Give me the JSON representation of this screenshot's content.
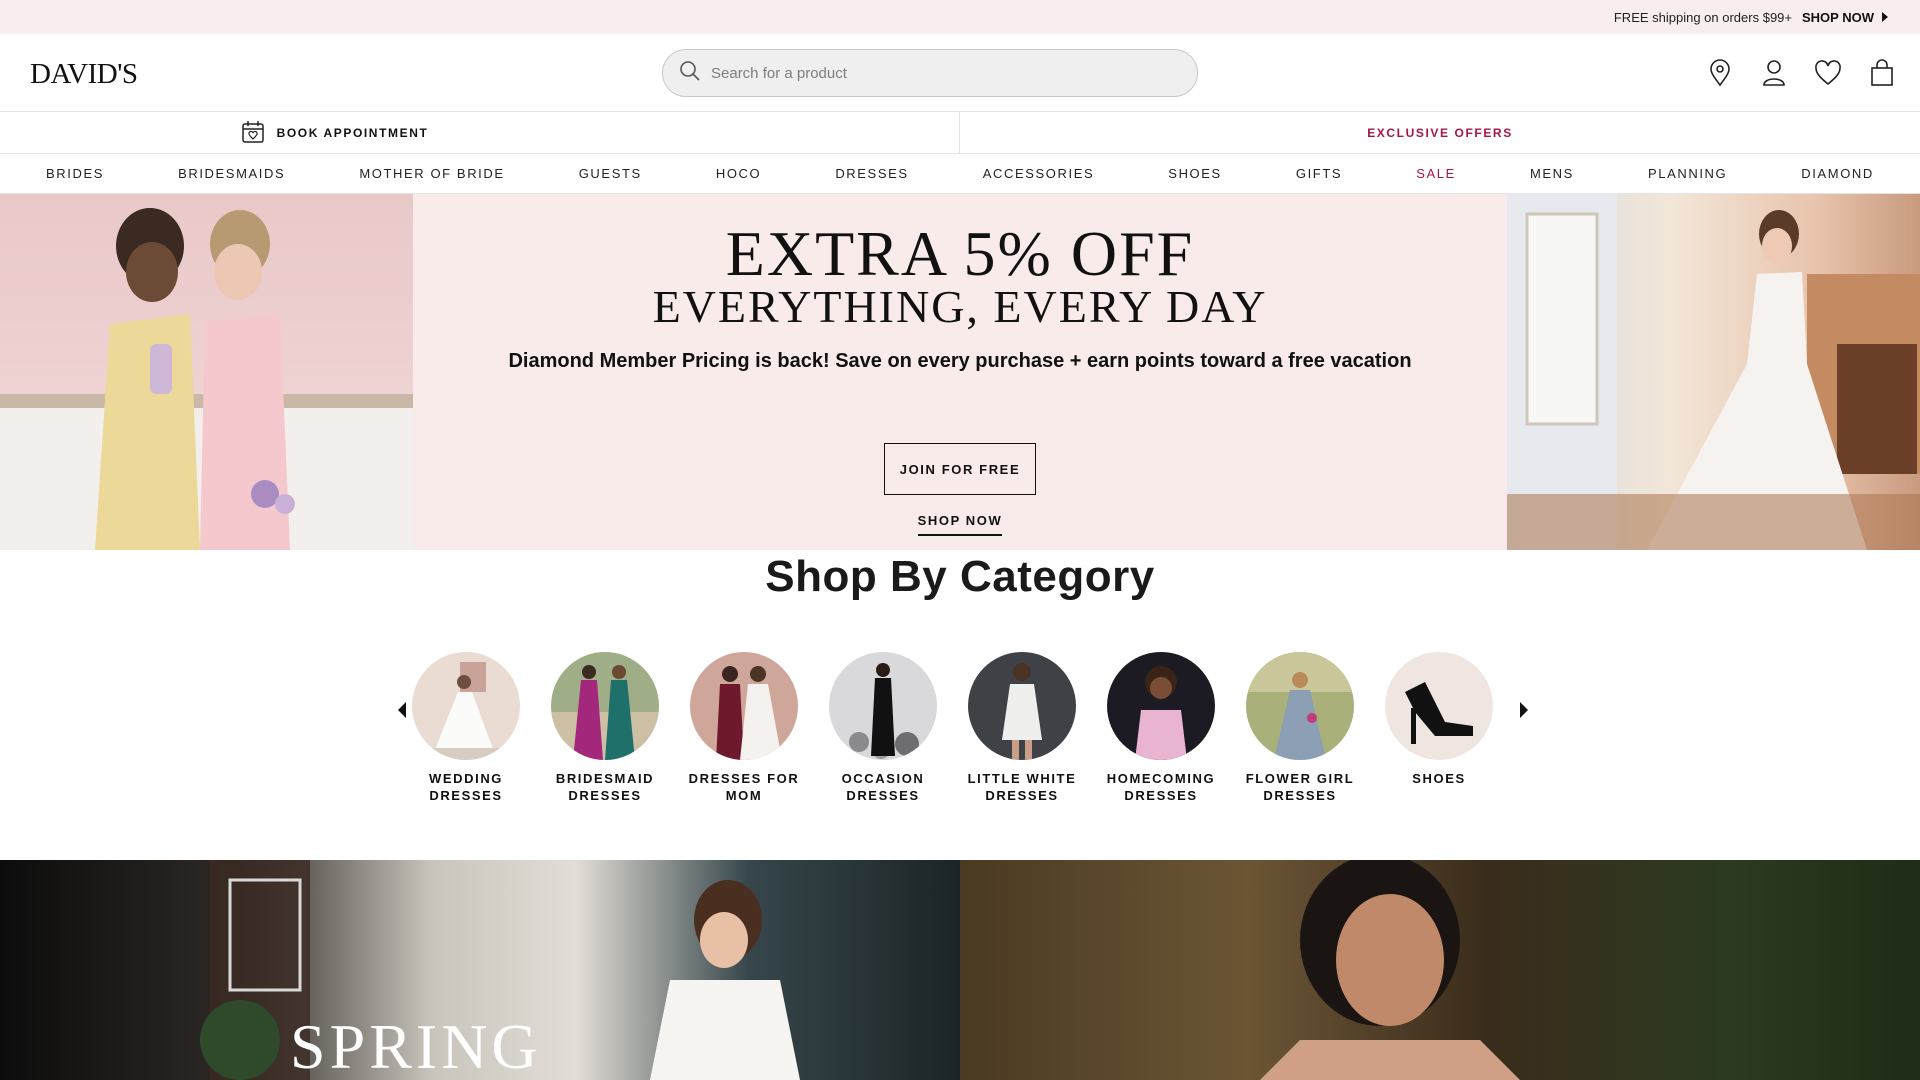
{
  "promo": {
    "text": "FREE shipping on orders $99+",
    "link": "SHOP NOW"
  },
  "header": {
    "logo": "DAVID'S",
    "search_placeholder": "Search for a product"
  },
  "subnav": {
    "appointment": "BOOK APPOINTMENT",
    "offers": "EXCLUSIVE OFFERS"
  },
  "nav": [
    "BRIDES",
    "BRIDESMAIDS",
    "MOTHER OF BRIDE",
    "GUESTS",
    "HOCO",
    "DRESSES",
    "ACCESSORIES",
    "SHOES",
    "GIFTS",
    "SALE",
    "MENS",
    "PLANNING",
    "DIAMOND"
  ],
  "hero": {
    "headline_1": "EXTRA 5% OFF",
    "headline_2": "EVERYTHING, EVERY DAY",
    "subhead": "Diamond Member Pricing is back! Save on every purchase + earn points toward a free vacation",
    "button": "JOIN FOR FREE",
    "link": "SHOP NOW"
  },
  "category": {
    "title": "Shop By Category",
    "items": [
      {
        "line1": "WEDDING",
        "line2": "DRESSES"
      },
      {
        "line1": "BRIDESMAID",
        "line2": "DRESSES"
      },
      {
        "line1": "DRESSES FOR",
        "line2": "MOM"
      },
      {
        "line1": "OCCASION",
        "line2": "DRESSES"
      },
      {
        "line1": "LITTLE WHITE",
        "line2": "DRESSES"
      },
      {
        "line1": "HOMECOMING",
        "line2": "DRESSES"
      },
      {
        "line1": "FLOWER GIRL",
        "line2": "DRESSES"
      },
      {
        "line1": "SHOES",
        "line2": ""
      }
    ]
  },
  "banner": {
    "spring_text": "SPRING"
  },
  "colors": {
    "accent": "#a8154b",
    "promo_bg": "#f8eef0",
    "hero_bg": "#f8ebea"
  }
}
